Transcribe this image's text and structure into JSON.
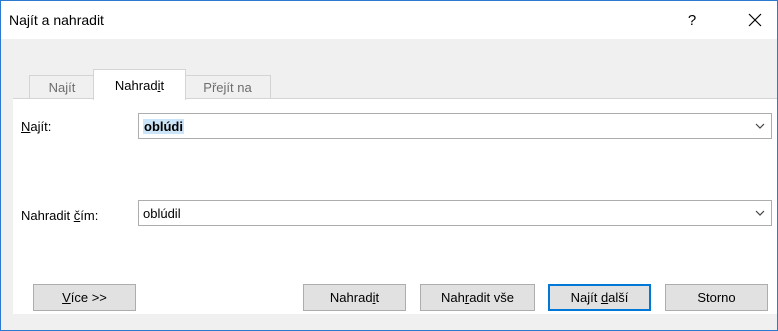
{
  "window": {
    "title": "Najít a nahradit",
    "help_label": "?",
    "close_icon": "close-icon"
  },
  "tabs": [
    {
      "pre": "Najít",
      "key": "",
      "post": "",
      "active": false
    },
    {
      "pre": "Nahrad",
      "key": "i",
      "post": "t",
      "active": true
    },
    {
      "pre": "Přejít na",
      "key": "",
      "post": "",
      "active": false
    }
  ],
  "find": {
    "label_key": "N",
    "label_rest": "ajít:",
    "value": "oblúdi"
  },
  "replace": {
    "label_pre": "Nahradit ",
    "label_key": "č",
    "label_post": "ím:",
    "value": "oblúdil"
  },
  "buttons": {
    "more_key": "V",
    "more_rest": "íce >>",
    "replace_pre": "Nahrad",
    "replace_key": "i",
    "replace_post": "t",
    "replace_all_pre": "Nah",
    "replace_all_key": "r",
    "replace_all_post": "adit vše",
    "find_next_pre": "Najít ",
    "find_next_key": "d",
    "find_next_post": "alší",
    "cancel": "Storno"
  },
  "colors": {
    "accent": "#0078d7",
    "selection": "#cce4f7"
  }
}
